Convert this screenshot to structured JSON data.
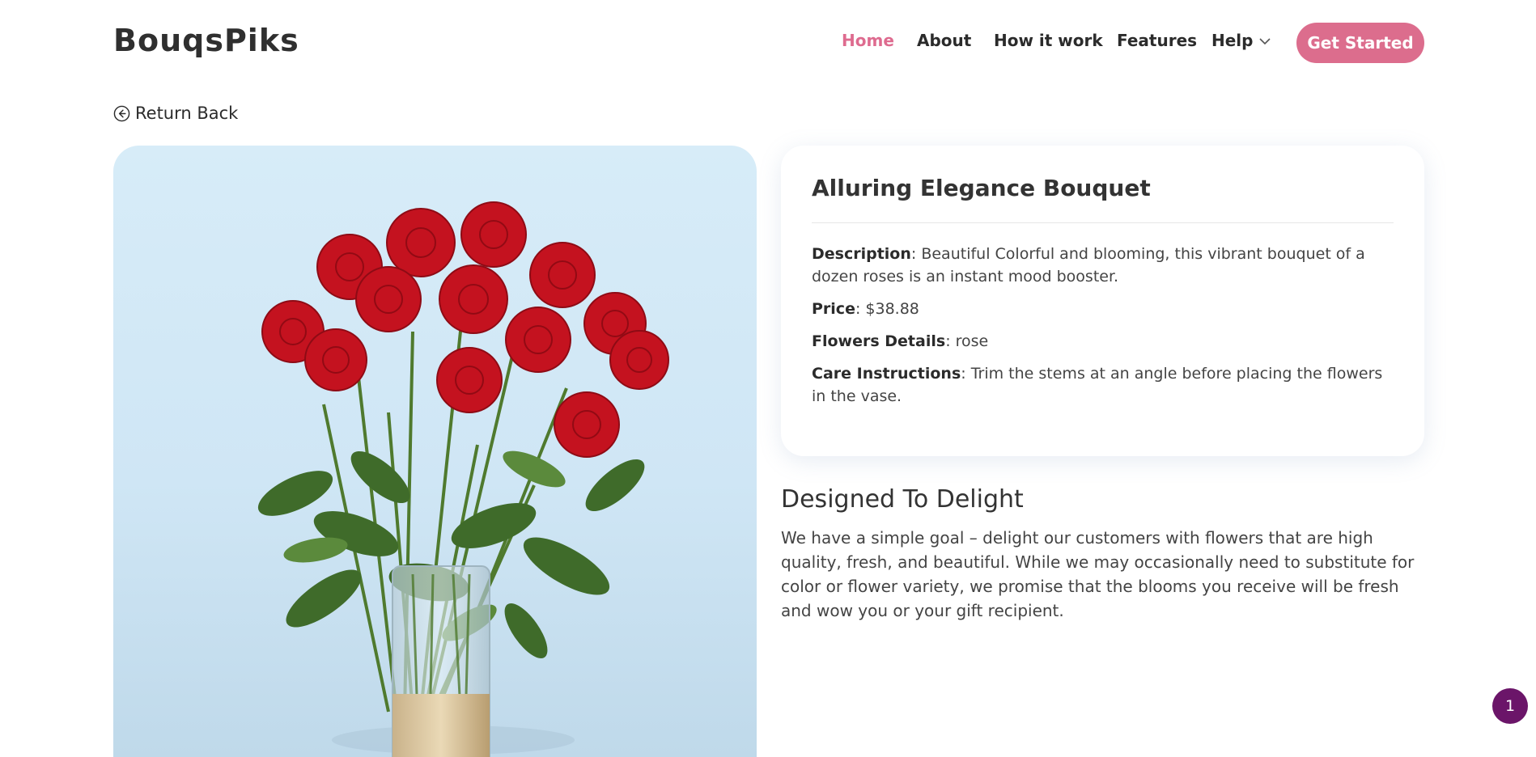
{
  "header": {
    "logo": "BouqsPiks",
    "nav": [
      {
        "label": "Home",
        "active": true
      },
      {
        "label": "About"
      },
      {
        "label": "How it work"
      },
      {
        "label": "Features"
      },
      {
        "label": "Help",
        "icon": "chevron-down-icon"
      }
    ],
    "cta_label": "Get Started"
  },
  "return_label": "Return Back",
  "product": {
    "title": "Alluring Elegance Bouquet",
    "description_label": "Description",
    "description": ": Beautiful Colorful and blooming, this vibrant bouquet of a dozen roses is an instant mood booster.",
    "price_label": "Price",
    "price": ": $38.88",
    "flowers_label": "Flowers Details",
    "flowers": ": rose",
    "care_label": "Care Instructions",
    "care": ": Trim the stems at an angle before placing the flowers in the vase."
  },
  "section": {
    "title": "Designed To Delight",
    "body": "We have a simple goal – delight our customers with flowers that are high quality, fresh, and beautiful. While we may occasionally need to substitute for color or flower variety, we promise that the blooms you receive will be fresh and wow you or your gift recipient."
  },
  "badge_count": "1",
  "colors": {
    "accent": "#dc6d8d",
    "badge": "#6b1569",
    "photo_bg": "#d7ecf8"
  }
}
